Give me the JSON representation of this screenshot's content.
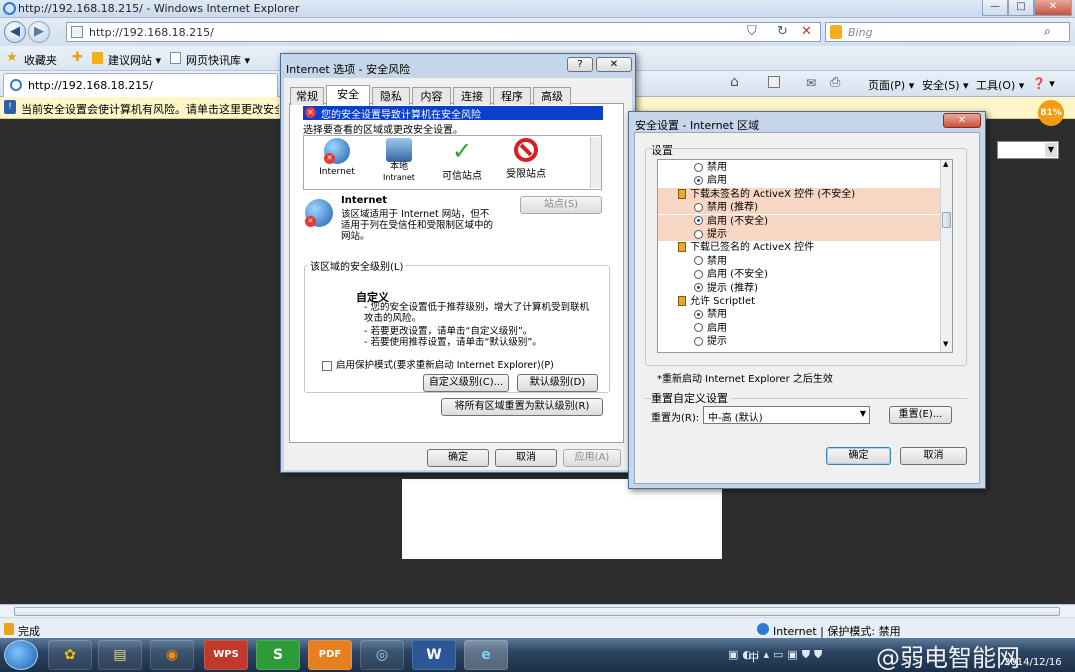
{
  "window": {
    "title": "http://192.168.18.215/ - Windows Internet Explorer",
    "minimize": "—",
    "maximize": "□",
    "close": "✕"
  },
  "address": {
    "url": "http://192.168.18.215/",
    "search_placeholder": "Bing"
  },
  "favorites": {
    "label": "收藏夹",
    "items": [
      "建议网站 ▾",
      "网页快讯库 ▾"
    ]
  },
  "tab": {
    "label": "http://192.168.18.215/"
  },
  "commandbar": {
    "page": "页面(P) ▾",
    "safety": "安全(S) ▾",
    "tools": "工具(O) ▾",
    "help": "❓ ▾"
  },
  "infobar": {
    "text": "当前安全设置会使计算机有风险。请单击这里更改安全设置"
  },
  "badge": {
    "value": "81%"
  },
  "status": {
    "done": "完成",
    "zone": "Internet | 保护模式: 禁用"
  },
  "taskbar": {
    "time": "",
    "date": "2014/12/16",
    "lang": "中",
    "watermark": "@弱电智能网",
    "apps": [
      "WPS",
      "S",
      "PDF",
      "W"
    ]
  },
  "dialog_options": {
    "title": "Internet 选项 - 安全风险",
    "help": "?",
    "close": "✕",
    "tabs": [
      "常规",
      "安全",
      "隐私",
      "内容",
      "连接",
      "程序",
      "高级"
    ],
    "warning": "您的安全设置导致计算机在安全风险",
    "select_zone": "选择要查看的区域或更改安全设置。",
    "zones": [
      {
        "name": "Internet",
        "sub": ""
      },
      {
        "name": "本地",
        "sub": "Intranet"
      },
      {
        "name": "可信站点",
        "sub": ""
      },
      {
        "name": "受限站点",
        "sub": ""
      }
    ],
    "zone_title": "Internet",
    "zone_desc": "该区域适用于 Internet 网站，但不适用于列在受信任和受限制区域中的网站。",
    "sites_button": "站点(S)",
    "level_group": "该区域的安全级别(L)",
    "level_name": "自定义",
    "level_lines": [
      "- 您的安全设置低于推荐级别，增大了计算机受到联机攻击的风险。",
      "- 若要更改设置，请单击“自定义级别”。",
      "- 若要使用推荐设置，请单击“默认级别”。"
    ],
    "protected_mode": "启用保护模式(要求重新启动 Internet Explorer)(P)",
    "custom_level": "自定义级别(C)...",
    "default_level": "默认级别(D)",
    "reset_all": "将所有区域重置为默认级别(R)",
    "ok": "确定",
    "cancel": "取消",
    "apply": "应用(A)"
  },
  "dialog_security": {
    "title": "安全设置 - Internet 区域",
    "close": "✕",
    "settings_label": "设置",
    "items": [
      {
        "kind": "radio",
        "text": "禁用",
        "checked": false
      },
      {
        "kind": "radio",
        "text": "启用",
        "checked": true
      },
      {
        "kind": "header",
        "text": "下载未签名的 ActiveX 控件 (不安全)"
      },
      {
        "kind": "radio",
        "text": "禁用 (推荐)",
        "checked": false
      },
      {
        "kind": "radio",
        "text": "启用 (不安全)",
        "checked": true
      },
      {
        "kind": "radio",
        "text": "提示",
        "checked": false
      },
      {
        "kind": "header",
        "text": "下载已签名的 ActiveX 控件"
      },
      {
        "kind": "radio",
        "text": "禁用",
        "checked": false
      },
      {
        "kind": "radio",
        "text": "启用 (不安全)",
        "checked": false
      },
      {
        "kind": "radio",
        "text": "提示 (推荐)",
        "checked": true
      },
      {
        "kind": "header",
        "text": "允许 Scriptlet"
      },
      {
        "kind": "radio",
        "text": "禁用",
        "checked": true
      },
      {
        "kind": "radio",
        "text": "启用",
        "checked": false
      },
      {
        "kind": "radio",
        "text": "提示",
        "checked": false
      }
    ],
    "footnote": "*重新启动 Internet Explorer 之后生效",
    "reset_group": "重置自定义设置",
    "reset_to_label": "重置为(R):",
    "reset_value": "中-高 (默认)",
    "reset_button": "重置(E)...",
    "ok": "确定",
    "cancel": "取消"
  },
  "colors": {
    "highlight_row": "#f7d7c3",
    "warning_bar": "#0a3fcb",
    "infobar": "#fef5c8"
  }
}
